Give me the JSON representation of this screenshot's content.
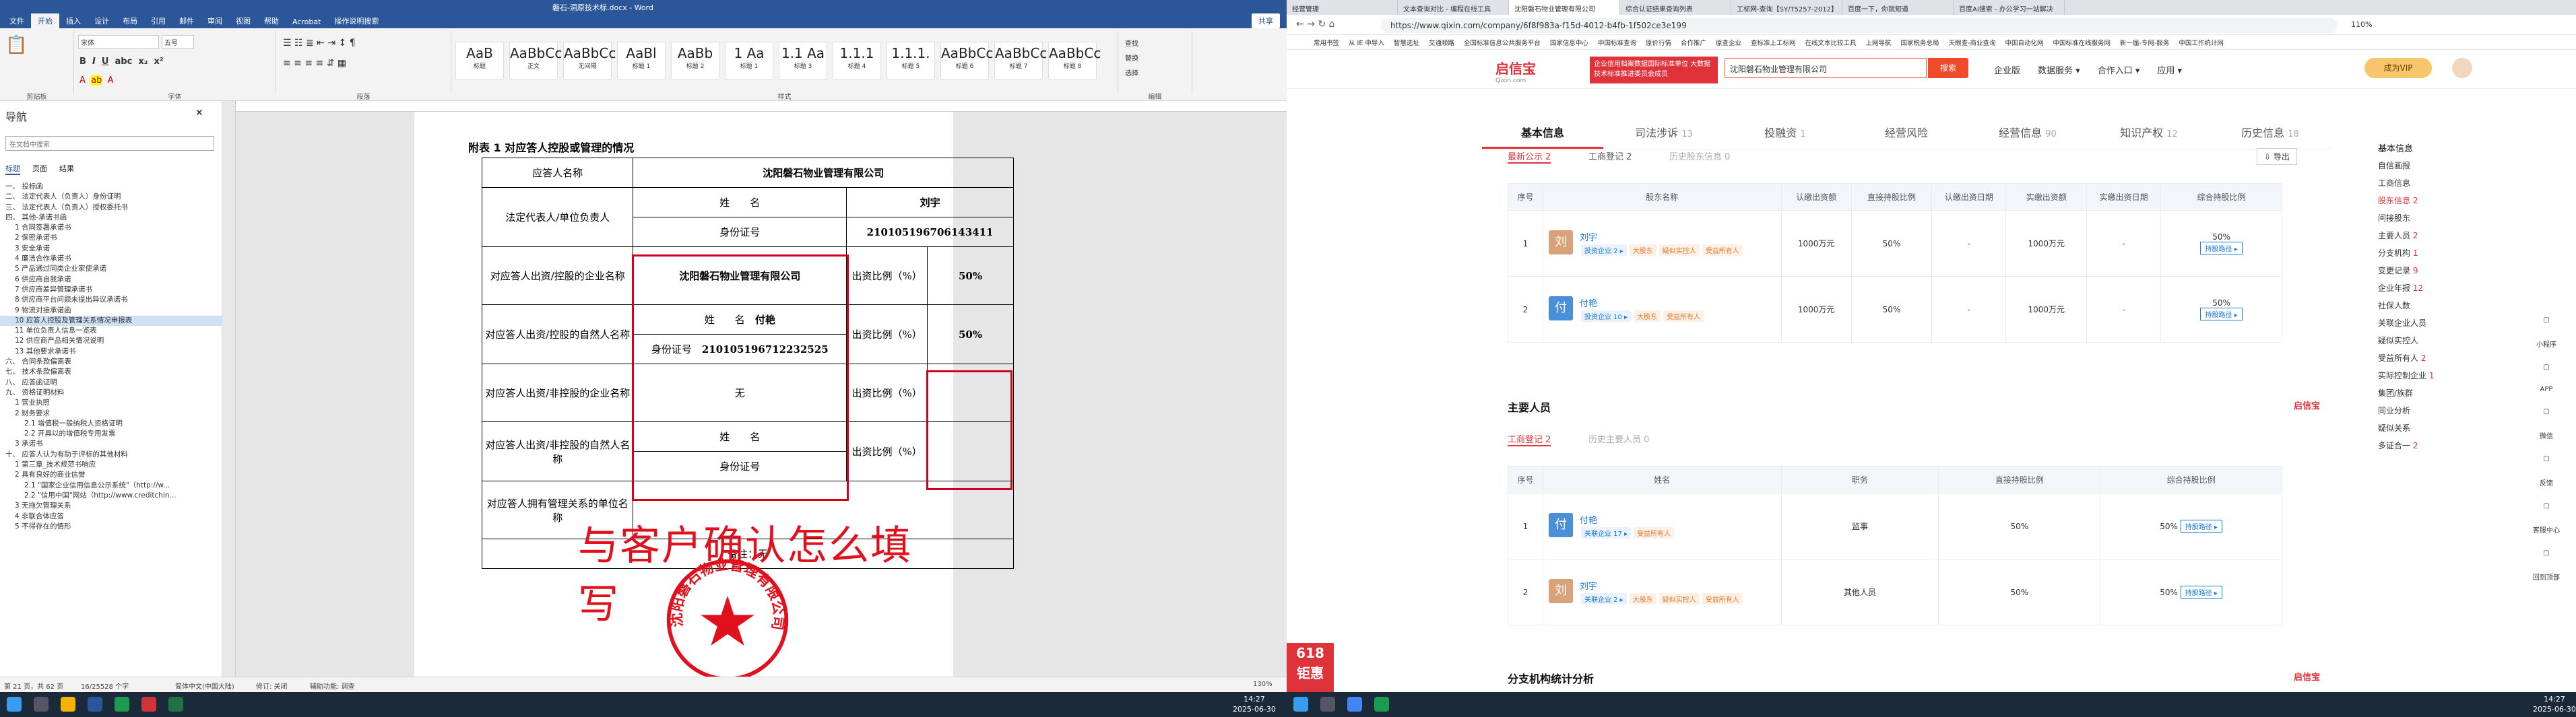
{
  "word": {
    "title": "磐石-洞原技术标.docx - Word",
    "tabs": [
      "文件",
      "开始",
      "插入",
      "设计",
      "布局",
      "引用",
      "邮件",
      "审阅",
      "视图",
      "帮助",
      "Acrobat",
      "操作说明搜索"
    ],
    "share": "共享",
    "font_name": "宋体",
    "font_size": "五号",
    "styles": [
      {
        "preview": "AaB",
        "name": "标题"
      },
      {
        "preview": "AaBbCcDd",
        "name": "正文"
      },
      {
        "preview": "AaBbCcDd",
        "name": "无间隔"
      },
      {
        "preview": "AaBl",
        "name": "标题 1"
      },
      {
        "preview": "AaBb",
        "name": "标题 2"
      },
      {
        "preview": "1 Aa",
        "name": "标题 1"
      },
      {
        "preview": "1.1 Aa",
        "name": "标题 3"
      },
      {
        "preview": "1.1.1",
        "name": "标题 4"
      },
      {
        "preview": "1.1.1.",
        "name": "标题 5"
      },
      {
        "preview": "AaBbCc",
        "name": "标题 6"
      },
      {
        "preview": "AaBbCc",
        "name": "标题 7"
      },
      {
        "preview": "AaBbCc",
        "name": "标题 8"
      }
    ],
    "edit": [
      "查找",
      "替换",
      "选择"
    ],
    "group_labels": {
      "clipboard": "剪贴板",
      "font": "字体",
      "para": "段落",
      "styles": "样式",
      "edit": "编辑"
    },
    "nav": {
      "title": "导航",
      "search_placeholder": "在文档中搜索",
      "view_tabs": [
        "标题",
        "页面",
        "结果"
      ],
      "items": [
        "一、 投标函",
        "二、 法定代表人（负责人）身份证明",
        "三、 法定代表人（负责人）授权委托书",
        "四、 其他-承诺书函",
        "1 合同签署承诺书",
        "2 保密承诺书",
        "3 安全承诺",
        "4 廉洁合作承诺书",
        "5 产品通过同类企业家使承诺",
        "6 供应商自我承诺",
        "7 供应商差异管理承诺书",
        "8 供应商平台问题未提出异议承诺书",
        "9 物流对接承诺函",
        "10 应答人控股及管理关系情况申报表",
        "11 单位负责人信息一览表",
        "12 供应商产品相关情况说明",
        "13 其他要求承诺书",
        "六、 合同条款偏离表",
        "七、 技术条款偏离表",
        "八、 应答函证明",
        "九、 资格证明材料",
        "1 营业执照",
        "2 财务要求",
        "2.1 增值税一般纳税人资格证明",
        "2.2 开具以的增值税专用发票",
        "3 承诺书",
        "十、 应答人认为有助于评标的其他材料",
        "1 第三章_技术规范书响应",
        "2 具有良好的商业信誉",
        "2.1 \"国家企业信用信息公示系统\"（http://w...",
        "2.2 \"信用中国\"网站（http://www.creditchin...",
        "3 无拖欠管理关系",
        "4 非联合体应答",
        "5 不得存在的情形"
      ],
      "selected": 13
    },
    "doc": {
      "title": "附表 1  对应答人控股或管理的情况",
      "company": "沈阳磐石物业管理有限公司",
      "labels": {
        "respondent": "应答人名称",
        "legal_rep": "法定代表人/单位负责人",
        "name": "姓　　名",
        "id": "身份证号",
        "inv_company": "对应答人出资/控股的企业名称",
        "inv_person": "对应答人出资/控股的自然人名称",
        "noninv_company": "对应答人出资/非控股的企业名称",
        "noninv_person": "对应答人出资/非控股的自然人名称",
        "mgmt": "对应答人拥有管理关系的单位名称",
        "ratio": "出资比例（%）",
        "note": "备注：无"
      },
      "legal_name": "刘宇",
      "legal_id": "210105196706143411",
      "shareholder_company": "沈阳磐石物业管理有限公司",
      "ratio1": "50%",
      "person_name": "付艳",
      "person_id": "210105196712232525",
      "ratio2": "50%",
      "none": "无",
      "annotation": "与客户确认怎么填写",
      "stamp_text": "沈阳磐石物业管理有限公司"
    },
    "status": {
      "page": "第 21 页，共 62 页",
      "words": "16/25528 个字",
      "lang": "简体中文(中国大陆)",
      "track": "修订: 关闭",
      "access": "辅助功能: 调查",
      "zoom": "130%"
    }
  },
  "browser": {
    "tabs": [
      "经营管理",
      "文本查询对比 - 编程在线工具",
      "沈阳磐石物业管理有限公司",
      "综合认证结果查询列表",
      "工标网-查询【SY/T5257-2012】",
      "百度一下，你就知道",
      "百度AI搜索 - 办公学习一站解决"
    ],
    "active_tab": 2,
    "url": "https://www.qixin.com/company/6f8f983a-f15d-4012-b4fb-1f502ce3e199",
    "zoom": "110%",
    "bookmarks": [
      "常用书签",
      "从 IE 中导入",
      "智慧选址",
      "交通顺路",
      "全国标准信息公共服务平台",
      "国家信息中心",
      "中国标准查询",
      "原价行情",
      "合作推广",
      "原查企业",
      "查标准上工标网",
      "在线文本比较工具",
      "上网导航",
      "国家税务总局",
      "天眼查-商业查询",
      "中国自动化网",
      "中国标准在线服务网",
      "新一届-专网-服务",
      "中国工作统计网"
    ],
    "header": {
      "logo": "启信宝",
      "logo_sub": "Qixin.com",
      "promo": "企业信用档案数据国际标准单位 大数据技术标准推进委员会成员",
      "search_value": "沈阳磐石物业管理有限公司",
      "search_btn": "搜索",
      "nav": [
        "企业版",
        "数据服务 ▾",
        "合作入口 ▾",
        "应用 ▾"
      ],
      "vip": "成为VIP"
    },
    "main_tabs": [
      {
        "label": "基本信息",
        "count": ""
      },
      {
        "label": "司法涉诉",
        "count": "13"
      },
      {
        "label": "投融资",
        "count": "1"
      },
      {
        "label": "经营风险",
        "count": ""
      },
      {
        "label": "经营信息",
        "count": "90"
      },
      {
        "label": "知识产权",
        "count": "12"
      },
      {
        "label": "历史信息",
        "count": "18"
      }
    ],
    "sh_subtabs": [
      "最新公示 2",
      "工商登记 2",
      "历史股东信息 0"
    ],
    "export": "导出",
    "sh_headers": [
      "序号",
      "股东名称",
      "认缴出资额",
      "直接持股比例",
      "认缴出资日期",
      "实缴出资额",
      "实缴出资日期",
      "综合持股比例"
    ],
    "shareholders": [
      {
        "no": "1",
        "avatar": "刘",
        "color": "#d9a27a",
        "name": "刘宇",
        "tags": [
          "投资企业 2 ▸",
          "大股东",
          "疑似实控人",
          "受益所有人"
        ],
        "subscribed": "1000万元",
        "ratio": "50%",
        "date": "-",
        "paid": "1000万元",
        "paid_date": "-",
        "total": "50%",
        "link": "持股路径 ▸"
      },
      {
        "no": "2",
        "avatar": "付",
        "color": "#4a90d9",
        "name": "付艳",
        "tags": [
          "投资企业 10 ▸",
          "大股东",
          "受益所有人"
        ],
        "subscribed": "1000万元",
        "ratio": "50%",
        "date": "-",
        "paid": "1000万元",
        "paid_date": "-",
        "total": "50%",
        "link": "持股路径 ▸"
      }
    ],
    "staff_title": "主要人员",
    "brand": "启信宝",
    "staff_subtabs": [
      "工商登记 2",
      "历史主要人员 0"
    ],
    "staff_headers": [
      "序号",
      "姓名",
      "职务",
      "直接持股比例",
      "综合持股比例"
    ],
    "staff": [
      {
        "no": "1",
        "avatar": "付",
        "color": "#4a90d9",
        "name": "付艳",
        "tags": [
          "关联企业 17 ▸",
          "受益所有人"
        ],
        "role": "监事",
        "ratio": "50%",
        "total": "50%",
        "link": "持股路径 ▸"
      },
      {
        "no": "2",
        "avatar": "刘",
        "color": "#d9a27a",
        "name": "刘宇",
        "tags": [
          "关联企业 2 ▸",
          "大股东",
          "疑似实控人",
          "受益所有人"
        ],
        "role": "其他人员",
        "ratio": "50%",
        "total": "50%",
        "link": "持股路径 ▸"
      }
    ],
    "branch_title": "分支机构统计分析",
    "right_nav": {
      "title": "基本信息",
      "items": [
        {
          "label": "自信画报",
          "count": ""
        },
        {
          "label": "工商信息",
          "count": ""
        },
        {
          "label": "股东信息",
          "count": "2"
        },
        {
          "label": "间接股东",
          "count": ""
        },
        {
          "label": "主要人员",
          "count": "2"
        },
        {
          "label": "分支机构",
          "count": "1"
        },
        {
          "label": "变更记录",
          "count": "9"
        },
        {
          "label": "企业年报",
          "count": "12"
        },
        {
          "label": "社保人数",
          "count": ""
        },
        {
          "label": "关联企业人员",
          "count": ""
        },
        {
          "label": "疑似实控人",
          "count": ""
        },
        {
          "label": "受益所有人",
          "count": "2"
        },
        {
          "label": "实际控制企业",
          "count": "1"
        },
        {
          "label": "集团/族群",
          "count": ""
        },
        {
          "label": "同业分析",
          "count": ""
        },
        {
          "label": "疑似关系",
          "count": ""
        },
        {
          "label": "多证合一",
          "count": "2"
        }
      ],
      "active": 2
    },
    "side_tools": [
      "小程序",
      "APP",
      "微信",
      "反馈",
      "客服中心",
      "回到顶部"
    ],
    "promo_618": [
      "618",
      "钜惠"
    ]
  },
  "taskbar": {
    "time_left": "14:27",
    "date_left": "2025-06-30",
    "time_right": "14:27",
    "date_right": "2025-06-30"
  }
}
